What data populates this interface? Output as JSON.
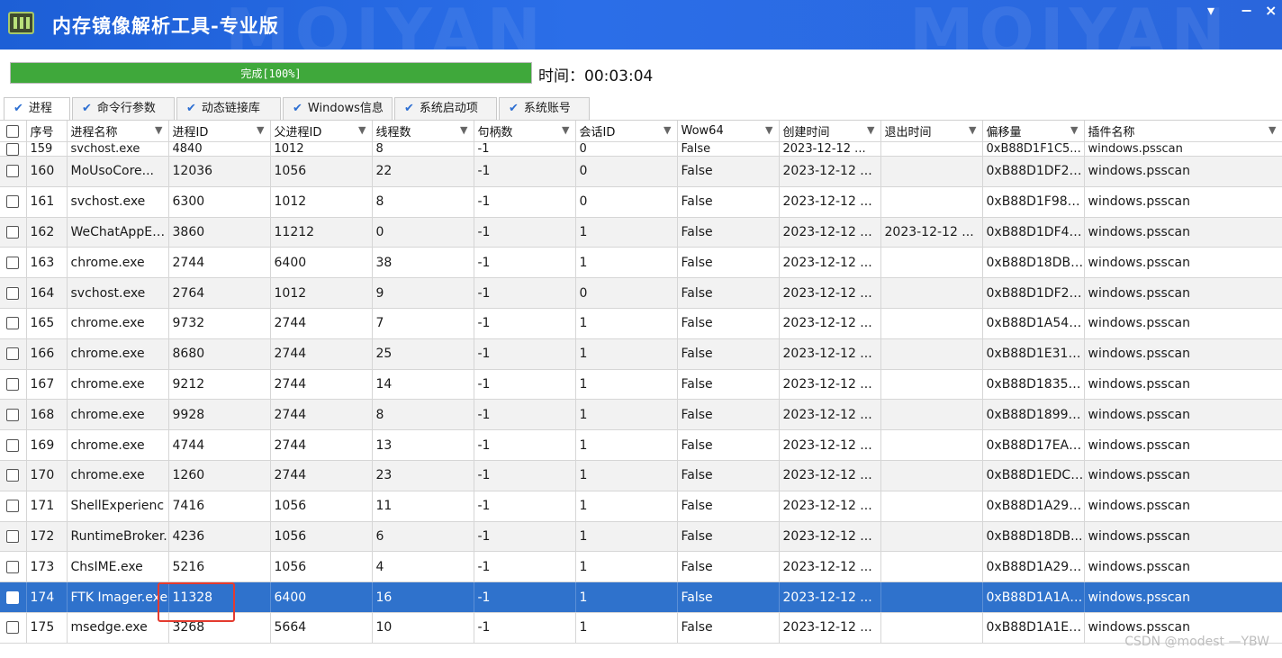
{
  "window": {
    "title": "内存镜像解析工具-专业版",
    "watermark_text": "MOIYAN",
    "pin_glyph": "▾",
    "min_glyph": "−",
    "close_glyph": "×",
    "accent": "#2b6ee8"
  },
  "progress": {
    "fraction": 1.0,
    "label": "完成[100%]",
    "time_label": "时间：00:03:04",
    "fill_color": "#3fa83b"
  },
  "tabs": [
    {
      "label": "进程",
      "active": true
    },
    {
      "label": "命令行参数",
      "active": false
    },
    {
      "label": "动态链接库",
      "active": false
    },
    {
      "label": "Windows信息",
      "active": false
    },
    {
      "label": "系统启动项",
      "active": false
    },
    {
      "label": "系统账号",
      "active": false
    }
  ],
  "grid": {
    "columns": [
      "序号",
      "进程名称",
      "进程ID",
      "父进程ID",
      "线程数",
      "句柄数",
      "会话ID",
      "Wow64",
      "创建时间",
      "退出时间",
      "偏移量",
      "插件名称"
    ],
    "filter_glyph": "▼",
    "rows": [
      [
        "159",
        "svchost.exe",
        "4840",
        "1012",
        "8",
        "-1",
        "0",
        "False",
        "2023-12-12 ...",
        "",
        "0xB88D1F1C5...",
        "windows.psscan"
      ],
      [
        "160",
        "MoUsoCore...",
        "12036",
        "1056",
        "22",
        "-1",
        "0",
        "False",
        "2023-12-12 ...",
        "",
        "0xB88D1DF2E...",
        "windows.psscan"
      ],
      [
        "161",
        "svchost.exe",
        "6300",
        "1012",
        "8",
        "-1",
        "0",
        "False",
        "2023-12-12 ...",
        "",
        "0xB88D1F988...",
        "windows.psscan"
      ],
      [
        "162",
        "WeChatAppEx...",
        "3860",
        "11212",
        "0",
        "-1",
        "1",
        "False",
        "2023-12-12 ...",
        "2023-12-12 ...",
        "0xB88D1DF41...",
        "windows.psscan"
      ],
      [
        "163",
        "chrome.exe",
        "2744",
        "6400",
        "38",
        "-1",
        "1",
        "False",
        "2023-12-12 ...",
        "",
        "0xB88D18DB8...",
        "windows.psscan"
      ],
      [
        "164",
        "svchost.exe",
        "2764",
        "1012",
        "9",
        "-1",
        "0",
        "False",
        "2023-12-12 ...",
        "",
        "0xB88D1DF20...",
        "windows.psscan"
      ],
      [
        "165",
        "chrome.exe",
        "9732",
        "2744",
        "7",
        "-1",
        "1",
        "False",
        "2023-12-12 ...",
        "",
        "0xB88D1A54C...",
        "windows.psscan"
      ],
      [
        "166",
        "chrome.exe",
        "8680",
        "2744",
        "25",
        "-1",
        "1",
        "False",
        "2023-12-12 ...",
        "",
        "0xB88D1E31D...",
        "windows.psscan"
      ],
      [
        "167",
        "chrome.exe",
        "9212",
        "2744",
        "14",
        "-1",
        "1",
        "False",
        "2023-12-12 ...",
        "",
        "0xB88D18357...",
        "windows.psscan"
      ],
      [
        "168",
        "chrome.exe",
        "9928",
        "2744",
        "8",
        "-1",
        "1",
        "False",
        "2023-12-12 ...",
        "",
        "0xB88D18992...",
        "windows.psscan"
      ],
      [
        "169",
        "chrome.exe",
        "4744",
        "2744",
        "13",
        "-1",
        "1",
        "False",
        "2023-12-12 ...",
        "",
        "0xB88D17EAF...",
        "windows.psscan"
      ],
      [
        "170",
        "chrome.exe",
        "1260",
        "2744",
        "23",
        "-1",
        "1",
        "False",
        "2023-12-12 ...",
        "",
        "0xB88D1EDC5...",
        "windows.psscan"
      ],
      [
        "171",
        "ShellExperienc",
        "7416",
        "1056",
        "11",
        "-1",
        "1",
        "False",
        "2023-12-12 ...",
        "",
        "0xB88D1A295...",
        "windows.psscan"
      ],
      [
        "172",
        "RuntimeBroker.",
        "4236",
        "1056",
        "6",
        "-1",
        "1",
        "False",
        "2023-12-12 ...",
        "",
        "0xB88D18DB...",
        "windows.psscan"
      ],
      [
        "173",
        "ChsIME.exe",
        "5216",
        "1056",
        "4",
        "-1",
        "1",
        "False",
        "2023-12-12 ...",
        "",
        "0xB88D1A296...",
        "windows.psscan"
      ],
      [
        "174",
        "FTK Imager.exe",
        "11328",
        "6400",
        "16",
        "-1",
        "1",
        "False",
        "2023-12-12 ...",
        "",
        "0xB88D1A1AA...",
        "windows.psscan"
      ],
      [
        "175",
        "msedge.exe",
        "3268",
        "5664",
        "10",
        "-1",
        "1",
        "False",
        "2023-12-12 ...",
        "",
        "0xB88D1A1E9...",
        "windows.psscan"
      ]
    ],
    "selected_row": "174",
    "selected_color": "#2f72cc"
  },
  "footer_watermark": "CSDN @modest —YBW"
}
